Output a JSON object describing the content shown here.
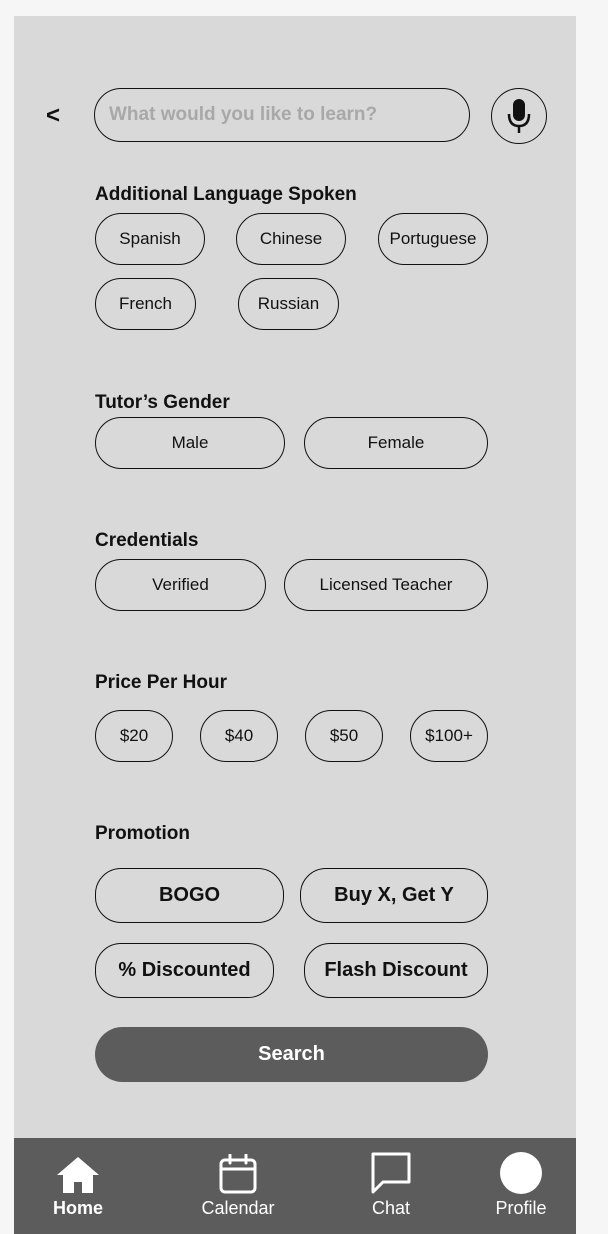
{
  "search": {
    "placeholder": "What would you like to learn?",
    "back_label": "<"
  },
  "sections": {
    "languages": {
      "title": "Additional Language Spoken",
      "options": [
        "Spanish",
        "Chinese",
        "Portuguese",
        "French",
        "Russian"
      ]
    },
    "gender": {
      "title": "Tutor’s Gender",
      "options": [
        "Male",
        "Female"
      ]
    },
    "credentials": {
      "title": "Credentials",
      "options": [
        "Verified",
        "Licensed Teacher"
      ]
    },
    "price": {
      "title": "Price Per Hour",
      "options": [
        "$20",
        "$40",
        "$50",
        "$100+"
      ]
    },
    "promotion": {
      "title": "Promotion",
      "options": [
        "BOGO",
        "Buy X, Get Y",
        "% Discounted",
        "Flash Discount"
      ]
    }
  },
  "search_button": {
    "label": "Search"
  },
  "nav": {
    "active": "Home",
    "items": [
      {
        "label": "Home",
        "icon": "home-icon"
      },
      {
        "label": "Calendar",
        "icon": "calendar-icon"
      },
      {
        "label": "Chat",
        "icon": "chat-icon"
      },
      {
        "label": "Profile",
        "icon": "profile-icon"
      }
    ]
  },
  "colors": {
    "frame": "#d9d9d9",
    "nav": "#5c5c5c",
    "button": "#5c5c5c",
    "placeholder": "#a8a8a8"
  }
}
